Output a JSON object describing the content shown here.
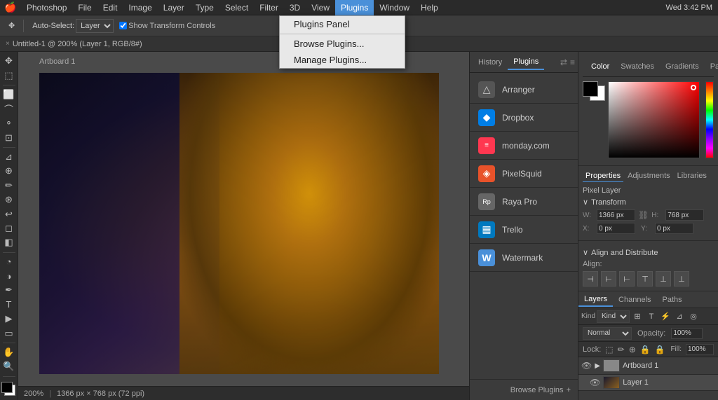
{
  "menubar": {
    "apple": "🍎",
    "items": [
      {
        "label": "Photoshop",
        "active": false
      },
      {
        "label": "File",
        "active": false
      },
      {
        "label": "Edit",
        "active": false
      },
      {
        "label": "Image",
        "active": false
      },
      {
        "label": "Layer",
        "active": false
      },
      {
        "label": "Type",
        "active": false
      },
      {
        "label": "Select",
        "active": false
      },
      {
        "label": "Filter",
        "active": false
      },
      {
        "label": "3D",
        "active": false
      },
      {
        "label": "View",
        "active": false
      },
      {
        "label": "Plugins",
        "active": true
      },
      {
        "label": "Window",
        "active": false
      },
      {
        "label": "Help",
        "active": false
      }
    ],
    "right": "Wed 3:42 PM"
  },
  "dropdown": {
    "items": [
      {
        "label": "Plugins Panel",
        "id": "plugins-panel-item"
      },
      {
        "label": "Browse Plugins...",
        "id": "browse-plugins-item"
      },
      {
        "label": "Manage Plugins...",
        "id": "manage-plugins-item"
      }
    ]
  },
  "toolbar": {
    "auto_select_label": "Auto-Select:",
    "layer_label": "Layer",
    "show_transform_label": "Show Transform Controls"
  },
  "tabbar": {
    "close": "×",
    "title": "Untitled-1 @ 200% (Layer 1, RGB/8#)"
  },
  "artboard": {
    "label": "Artboard 1"
  },
  "plugins_panel": {
    "tabs": [
      {
        "label": "History",
        "active": false
      },
      {
        "label": "Plugins",
        "active": true
      }
    ],
    "items": [
      {
        "name": "Arranger",
        "icon": "△",
        "icon_bg": "#555",
        "id": "arranger"
      },
      {
        "name": "Dropbox",
        "icon": "◆",
        "icon_bg": "#007ee5",
        "id": "dropbox"
      },
      {
        "name": "monday.com",
        "icon": "≡",
        "icon_bg": "#ff3750",
        "id": "monday"
      },
      {
        "name": "PixelSquid",
        "icon": "◈",
        "icon_bg": "#e8522a",
        "id": "pixelsquid"
      },
      {
        "name": "Raya Pro",
        "icon": "Rp",
        "icon_bg": "#666",
        "id": "rayapro"
      },
      {
        "name": "Trello",
        "icon": "▦",
        "icon_bg": "#0079bf",
        "id": "trello"
      },
      {
        "name": "Watermark",
        "icon": "W",
        "icon_bg": "#4a90d9",
        "id": "watermark"
      }
    ],
    "browse_label": "Browse Plugins",
    "browse_icon": "+"
  },
  "right_panel": {
    "tabs": [
      {
        "label": "Color",
        "active": true
      },
      {
        "label": "Swatches",
        "active": false
      },
      {
        "label": "Gradients",
        "active": false
      },
      {
        "label": "Patterns",
        "active": false
      }
    ],
    "properties": {
      "tabs": [
        {
          "label": "Properties",
          "active": true
        },
        {
          "label": "Adjustments",
          "active": false
        },
        {
          "label": "Libraries",
          "active": false
        }
      ],
      "layer_type": "Pixel Layer",
      "transform_title": "Transform",
      "align_title": "Align and Distribute",
      "align_label": "Align:",
      "w_label": "W:",
      "h_label": "H:",
      "x_label": "X:",
      "y_label": "Y:",
      "w_value": "1366 px",
      "h_value": "768 px",
      "x_value": "0 px",
      "y_value": "0 px"
    },
    "layers": {
      "tabs": [
        {
          "label": "Layers",
          "active": true
        },
        {
          "label": "Channels",
          "active": false
        },
        {
          "label": "Paths",
          "active": false
        }
      ],
      "kind_label": "Kind",
      "mode_label": "Normal",
      "opacity_label": "Opacity:",
      "opacity_value": "100%",
      "lock_label": "Lock:",
      "fill_label": "Fill:",
      "fill_value": "100%",
      "items": [
        {
          "name": "Artboard 1",
          "type": "group",
          "visible": true
        },
        {
          "name": "Layer 1",
          "type": "layer",
          "visible": true
        }
      ]
    }
  },
  "statusbar": {
    "zoom": "200%",
    "info": "1366 px × 768 px (72 ppi)"
  }
}
